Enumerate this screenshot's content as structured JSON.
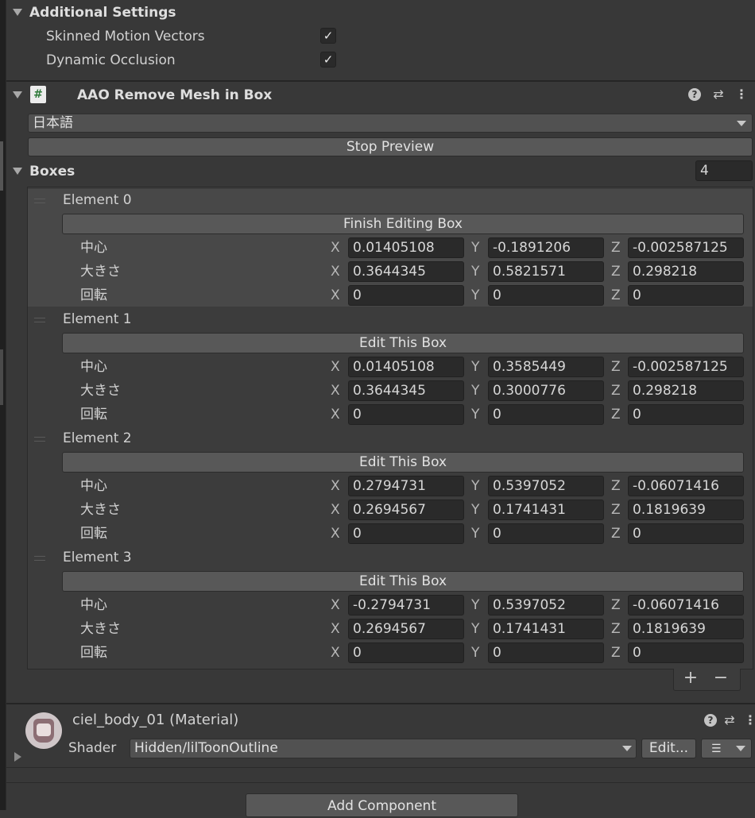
{
  "additional_settings": {
    "title": "Additional Settings",
    "skinned_motion_vectors": {
      "label": "Skinned Motion Vectors",
      "checked": true
    },
    "dynamic_occlusion": {
      "label": "Dynamic Occlusion",
      "checked": true
    }
  },
  "component": {
    "title": "AAO Remove Mesh in Box",
    "icon": "script-hash-icon",
    "language": "日本語",
    "preview_button": "Stop Preview",
    "boxes_label": "Boxes",
    "boxes_count": "4"
  },
  "row_labels": {
    "center": "中心",
    "size": "大きさ",
    "rotation": "回転"
  },
  "axis_labels": {
    "x": "X",
    "y": "Y",
    "z": "Z"
  },
  "elements": [
    {
      "label": "Element 0",
      "button": "Finish Editing Box",
      "selected": true,
      "center": [
        "0.01405108",
        "-0.1891206",
        "-0.002587125"
      ],
      "size": [
        "0.3644345",
        "0.5821571",
        "0.298218"
      ],
      "rotation": [
        "0",
        "0",
        "0"
      ]
    },
    {
      "label": "Element 1",
      "button": "Edit This Box",
      "selected": false,
      "center": [
        "0.01405108",
        "0.3585449",
        "-0.002587125"
      ],
      "size": [
        "0.3644345",
        "0.3000776",
        "0.298218"
      ],
      "rotation": [
        "0",
        "0",
        "0"
      ]
    },
    {
      "label": "Element 2",
      "button": "Edit This Box",
      "selected": false,
      "center": [
        "0.2794731",
        "0.5397052",
        "-0.06071416"
      ],
      "size": [
        "0.2694567",
        "0.1741431",
        "0.1819639"
      ],
      "rotation": [
        "0",
        "0",
        "0"
      ]
    },
    {
      "label": "Element 3",
      "button": "Edit This Box",
      "selected": false,
      "center": [
        "-0.2794731",
        "0.5397052",
        "-0.06071416"
      ],
      "size": [
        "0.2694567",
        "0.1741431",
        "0.1819639"
      ],
      "rotation": [
        "0",
        "0",
        "0"
      ]
    }
  ],
  "list_footer": {
    "add": "+",
    "remove": "−"
  },
  "material": {
    "title": "ciel_body_01 (Material)",
    "shader_label": "Shader",
    "shader_value": "Hidden/lilToonOutline",
    "edit_button": "Edit..."
  },
  "add_component_button": "Add Component",
  "colors": {
    "background": "#383838",
    "field": "#2a2a2a",
    "button": "#585858",
    "selected_element": "#484848"
  }
}
